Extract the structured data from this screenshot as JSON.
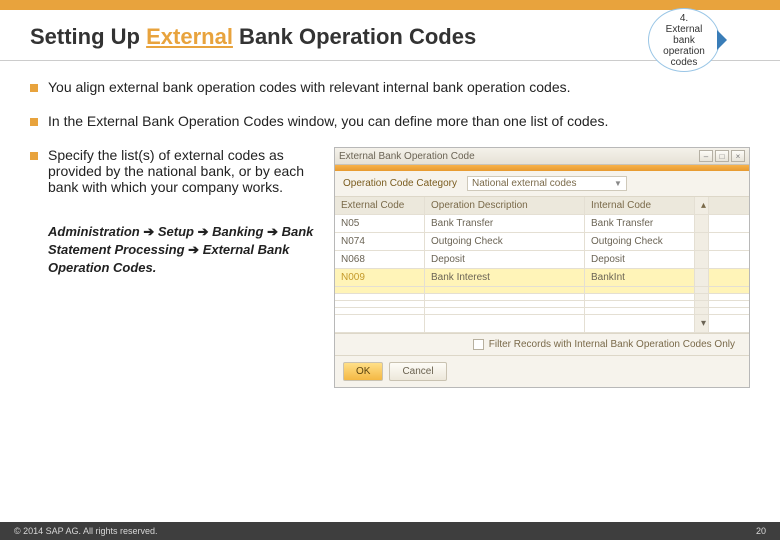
{
  "title_parts": {
    "pre": "Setting Up ",
    "accent": "External",
    "post": " Bank Operation Codes"
  },
  "badge": {
    "num": "4.",
    "l1": "External",
    "l2": "bank",
    "l3": "operation",
    "l4": "codes"
  },
  "bullets": {
    "b1": "You align external bank operation codes with relevant internal bank operation codes.",
    "b2": "In the External Bank Operation Codes window, you can define more than one list of codes.",
    "b3": "Specify the list(s) of external codes as provided by the national bank, or by each bank with which your company works."
  },
  "navpath": {
    "p1": "Administration",
    "p2": "Setup",
    "p3": "Banking",
    "p4": "Bank Statement Processing",
    "p5": "External Bank Operation Codes."
  },
  "win": {
    "title": "External Bank Operation Code",
    "catLabel": "Operation Code Category",
    "catValue": "National external codes",
    "headers": {
      "c1": "External Code",
      "c2": "Operation Description",
      "c3": "Internal Code"
    },
    "rows": [
      {
        "c1": "N05",
        "c2": "Bank Transfer",
        "c3": "Bank Transfer"
      },
      {
        "c1": "N074",
        "c2": "Outgoing Check",
        "c3": "Outgoing Check"
      },
      {
        "c1": "N068",
        "c2": "Deposit",
        "c3": "Deposit"
      },
      {
        "c1": "N009",
        "c2": "Bank Interest",
        "c3": "BankInt"
      }
    ],
    "filter": "Filter Records with Internal Bank Operation Codes Only",
    "ok": "OK",
    "cancel": "Cancel"
  },
  "footer": {
    "copy": "© 2014 SAP AG. All rights reserved.",
    "page": "20"
  }
}
